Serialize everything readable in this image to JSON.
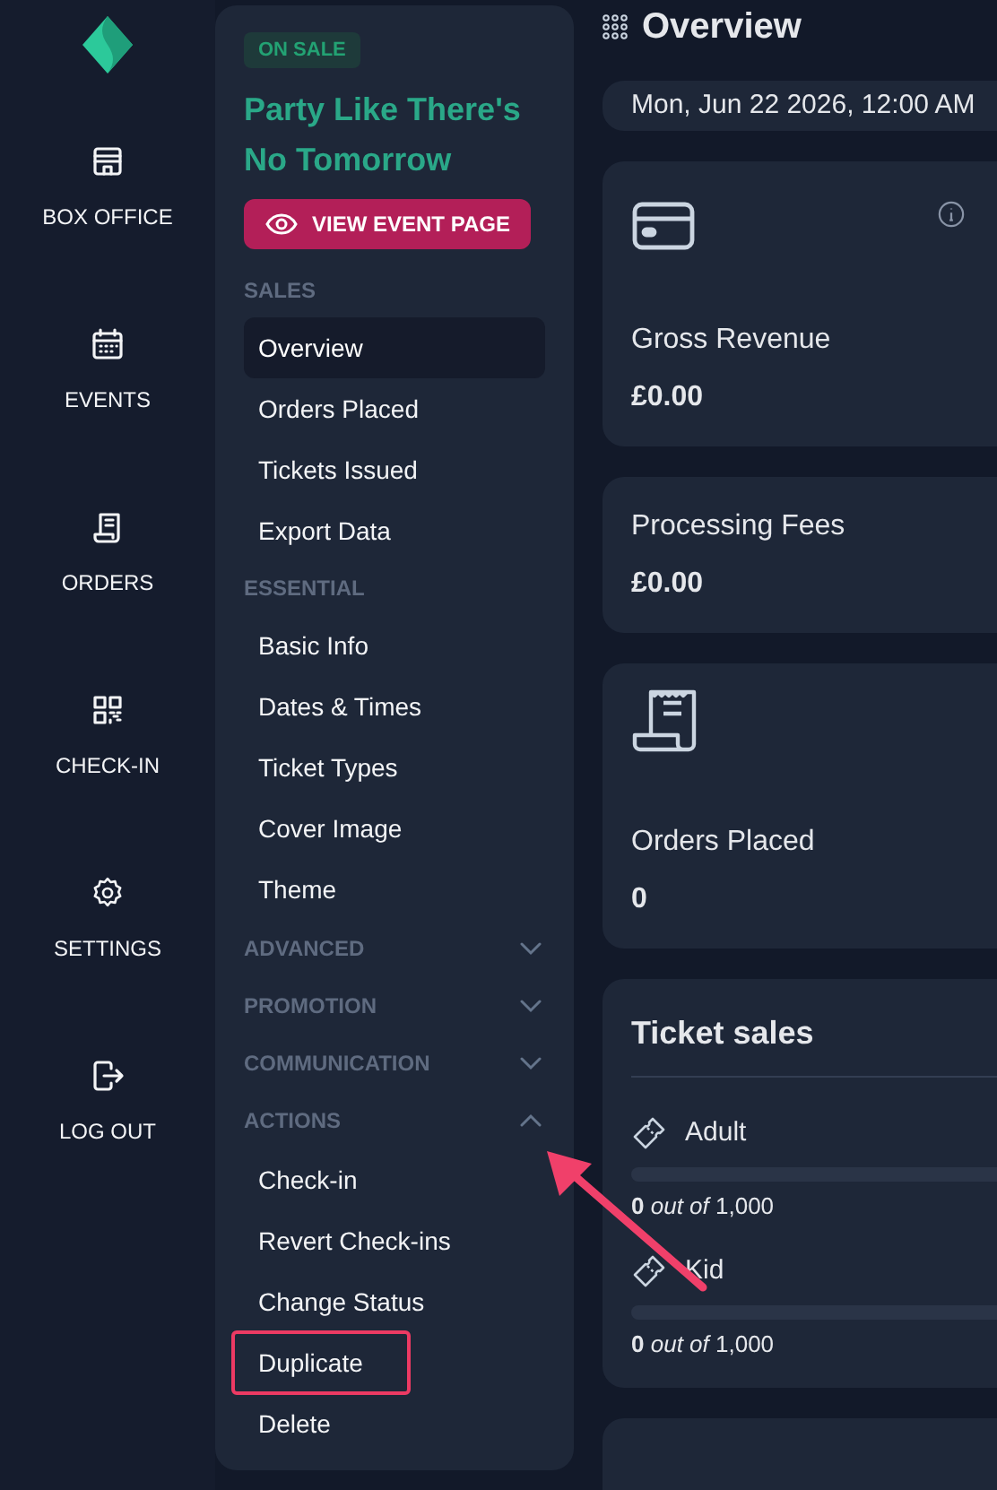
{
  "rail": {
    "items": [
      {
        "label": "BOX OFFICE"
      },
      {
        "label": "EVENTS"
      },
      {
        "label": "ORDERS"
      },
      {
        "label": "CHECK-IN"
      },
      {
        "label": "SETTINGS"
      },
      {
        "label": "LOG OUT"
      }
    ]
  },
  "event_panel": {
    "status_badge": "ON SALE",
    "title": "Party Like There's No Tomorrow",
    "view_button": "VIEW EVENT PAGE",
    "sections": [
      {
        "title": "SALES",
        "kind": "static",
        "items": [
          {
            "label": "Overview",
            "selected": true,
            "highlighted": false
          },
          {
            "label": "Orders Placed",
            "selected": false,
            "highlighted": false
          },
          {
            "label": "Tickets Issued",
            "selected": false,
            "highlighted": false
          },
          {
            "label": "Export Data",
            "selected": false,
            "highlighted": false
          }
        ]
      },
      {
        "title": "ESSENTIAL",
        "kind": "static",
        "items": [
          {
            "label": "Basic Info",
            "selected": false,
            "highlighted": false
          },
          {
            "label": "Dates & Times",
            "selected": false,
            "highlighted": false
          },
          {
            "label": "Ticket Types",
            "selected": false,
            "highlighted": false
          },
          {
            "label": "Cover Image",
            "selected": false,
            "highlighted": false
          },
          {
            "label": "Theme",
            "selected": false,
            "highlighted": false
          }
        ]
      },
      {
        "title": "ADVANCED",
        "kind": "collapsible",
        "expanded": false
      },
      {
        "title": "PROMOTION",
        "kind": "collapsible",
        "expanded": false
      },
      {
        "title": "COMMUNICATION",
        "kind": "collapsible",
        "expanded": false
      },
      {
        "title": "ACTIONS",
        "kind": "collapsible",
        "expanded": true,
        "items": [
          {
            "label": "Check-in",
            "selected": false,
            "highlighted": false
          },
          {
            "label": "Revert Check-ins",
            "selected": false,
            "highlighted": false
          },
          {
            "label": "Change Status",
            "selected": false,
            "highlighted": false
          },
          {
            "label": "Duplicate",
            "selected": false,
            "highlighted": true
          },
          {
            "label": "Delete",
            "selected": false,
            "highlighted": false
          }
        ]
      }
    ]
  },
  "main": {
    "title": "Overview",
    "date": "Mon, Jun 22 2026, 12:00 AM",
    "stats": [
      {
        "kind": "revenue",
        "label": "Gross Revenue",
        "value": "£0.00"
      },
      {
        "kind": "fees",
        "label": "Processing Fees",
        "value": "£0.00"
      },
      {
        "kind": "orders",
        "label": "Orders Placed",
        "value": "0"
      }
    ],
    "ticket_sales": {
      "title": "Ticket sales",
      "tickets": [
        {
          "name": "Adult",
          "level": 0,
          "caption": "**0** *out of* 1,000"
        },
        {
          "name": "Kid",
          "level": 0,
          "caption": "**0** *out of* 1,000"
        }
      ]
    }
  }
}
